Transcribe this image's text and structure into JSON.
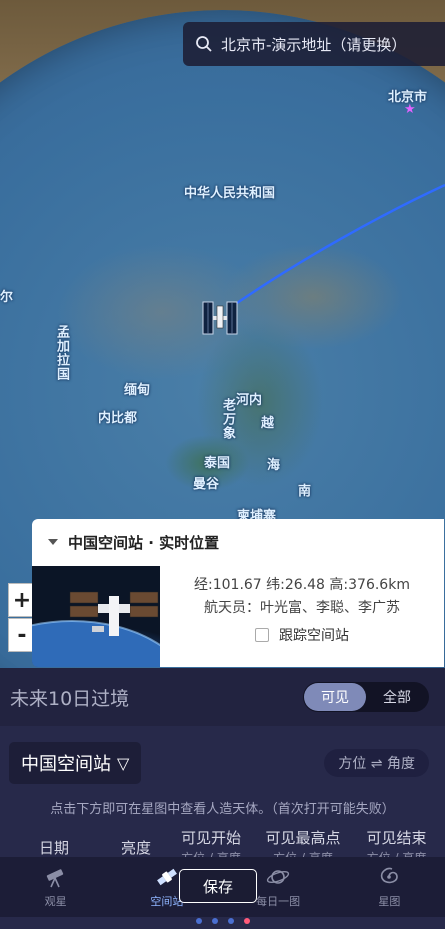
{
  "search": {
    "text": "北京市-演示地址（请更换）"
  },
  "map": {
    "labels": {
      "beijing": "北京市",
      "china": "中华人民共和国",
      "bangladesh": "孟加拉国",
      "myanmar": "缅甸",
      "naypyidaw": "内比都",
      "hanoi": "河内",
      "laos": "老万象",
      "vietnam_1": "越",
      "vietnam_2": "南",
      "thailand": "泰国",
      "bangkok": "曼谷",
      "cambodia": "柬埔寨",
      "hai": "海",
      "left_edge": "尔"
    },
    "zoom_in": "+",
    "zoom_out": "-"
  },
  "info_card": {
    "title": "中国空间站 · 实时位置",
    "position": "经:101.67 纬:26.48 高:376.6km",
    "astronauts": "航天员：叶光富、李聪、李广苏",
    "track_label": "跟踪空间站",
    "track_checked": false
  },
  "panel": {
    "title": "未来10日过境",
    "segment": {
      "visible": "可见",
      "all": "全部",
      "selected": "可见"
    },
    "satellite": "中国空间站",
    "satellite_caret": "▽",
    "direction_toggle": "方位 ⇌ 角度",
    "hint": "点击下方即可在星图中查看人造天体。（首次打开可能失败）",
    "columns": [
      {
        "title": "日期",
        "sub": ""
      },
      {
        "title": "亮度",
        "sub": ""
      },
      {
        "title": "可见开始",
        "sub": "方位 / 高度"
      },
      {
        "title": "可见最高点",
        "sub": "方位 / 高度"
      },
      {
        "title": "可见结束",
        "sub": "方位 / 高度"
      }
    ]
  },
  "bottom_nav": {
    "items": [
      {
        "label": "观星",
        "icon": "telescope-icon"
      },
      {
        "label": "空间站",
        "icon": "satellite-icon",
        "active": true
      },
      {
        "label": "每日一图",
        "icon": "planet-icon"
      },
      {
        "label": "星图",
        "icon": "galaxy-icon"
      }
    ],
    "save_label": "保存"
  },
  "pager": {
    "count": 4,
    "active_index": 3
  },
  "colors": {
    "panel_bg": "#27294a",
    "accent": "#7f8ab8",
    "active_nav": "#8fb5ff",
    "orbit_line": "#2f6bff",
    "active_dot": "#ff5a7a"
  }
}
